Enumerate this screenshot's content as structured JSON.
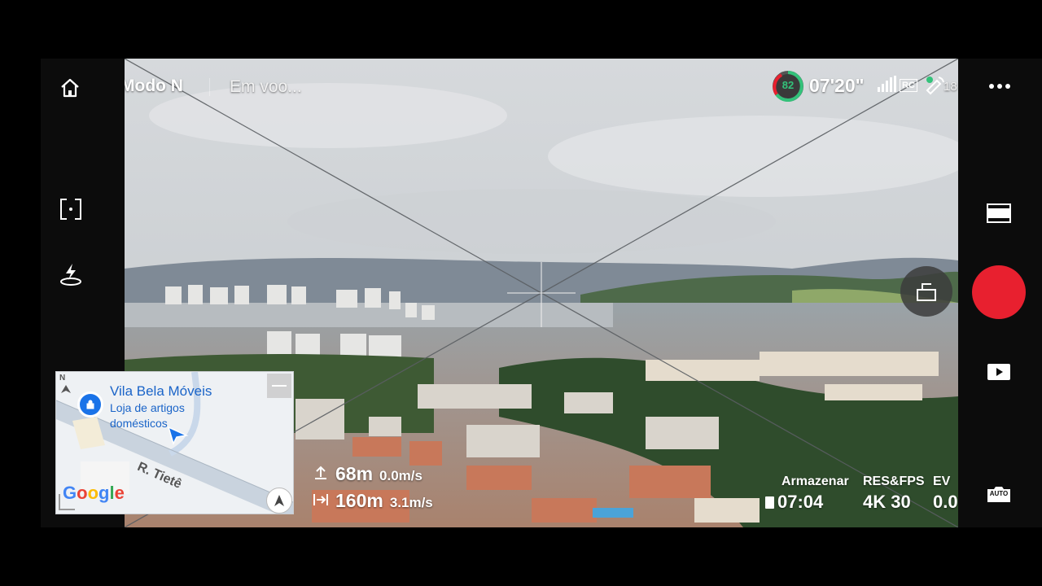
{
  "header": {
    "mode": "Modo N",
    "status": "Em voo...",
    "battery_percent": "82",
    "flight_time": "07'20\"",
    "rc_label": "RC",
    "satellites": "18"
  },
  "map": {
    "place_name": "Vila Bela Móveis",
    "place_category_line1": "Loja de artigos",
    "place_category_line2": "domésticos",
    "street": "R. Tietê",
    "provider": "Google",
    "north_label": "N"
  },
  "telemetry": {
    "height_value": "68m",
    "vertical_speed": "0.0m/s",
    "distance_value": "160m",
    "horizontal_speed": "3.1m/s"
  },
  "camera": {
    "storage_label": "Armazenar",
    "storage_time": "07:04",
    "resfps_label": "RES&FPS",
    "resfps_value": "4K 30",
    "ev_label": "EV",
    "ev_value": "0.0",
    "auto_label": "AUTO"
  },
  "colors": {
    "record_button": "#e8202f",
    "battery_ring": "#33c27a",
    "map_accent": "#1a73e8",
    "place_text": "#1a64c8"
  }
}
